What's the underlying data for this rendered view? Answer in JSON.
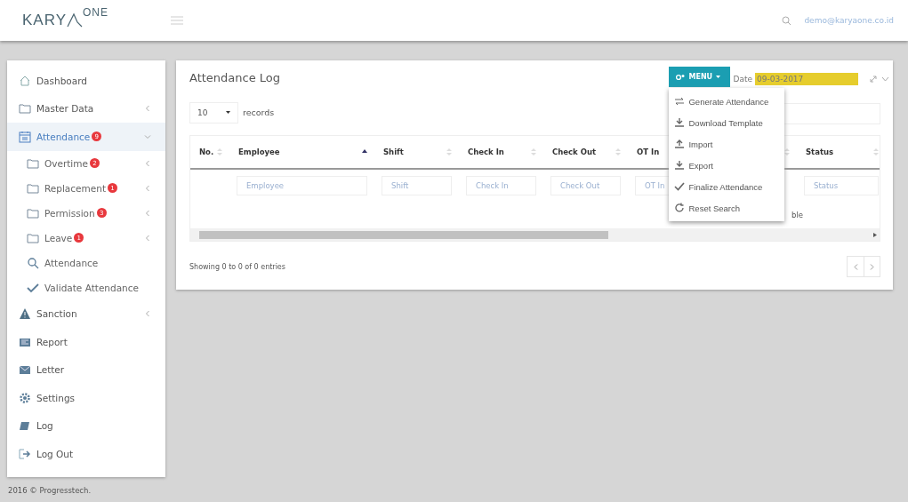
{
  "header": {
    "logo": "KARY",
    "logo_sup": "ONE",
    "user": "demo@karyaone.co.id"
  },
  "sidebar": {
    "items": [
      {
        "label": "Dashboard",
        "kind": "link",
        "selected": false
      },
      {
        "label": "Master Data",
        "kind": "group",
        "expanded": false,
        "selected": false
      },
      {
        "label": "Attendance",
        "kind": "group",
        "expanded": true,
        "selected": true,
        "badge": "9",
        "children": [
          {
            "label": "Overtime",
            "kind": "group",
            "expanded": false,
            "badge": "2"
          },
          {
            "label": "Replacement",
            "kind": "group",
            "expanded": false,
            "badge": "1"
          },
          {
            "label": "Permission",
            "kind": "group",
            "expanded": false,
            "badge": "3"
          },
          {
            "label": "Leave",
            "kind": "group",
            "expanded": false,
            "badge": "1"
          },
          {
            "label": "Attendance",
            "kind": "link"
          },
          {
            "label": "Validate Attendance",
            "kind": "link"
          }
        ]
      },
      {
        "label": "Sanction",
        "kind": "group",
        "expanded": false,
        "selected": false
      },
      {
        "label": "Report",
        "kind": "link",
        "selected": false
      },
      {
        "label": "Letter",
        "kind": "link",
        "selected": false
      },
      {
        "label": "Settings",
        "kind": "link",
        "selected": false
      },
      {
        "label": "Log",
        "kind": "link",
        "selected": false
      },
      {
        "label": "Log Out",
        "kind": "link",
        "selected": false
      }
    ]
  },
  "panel": {
    "title": "Attendance Log",
    "menu_button": "MENU",
    "date_label": "Date",
    "date_value": "09-03-2017",
    "menu": {
      "expanded": true,
      "items": [
        "Generate Attendance",
        "Download Template",
        "Import",
        "Export",
        "Finalize Attendance",
        "Reset Search"
      ]
    },
    "page_size": "10",
    "page_size_label": "records",
    "table": {
      "columns": [
        {
          "label": "No.",
          "sorted": false
        },
        {
          "label": "Employee",
          "sorted": true,
          "placeholder": "Employee"
        },
        {
          "label": "Shift",
          "sorted": false,
          "placeholder": "Shift"
        },
        {
          "label": "Check In",
          "sorted": false,
          "placeholder": "Check In"
        },
        {
          "label": "Check Out",
          "sorted": false,
          "placeholder": "Check Out"
        },
        {
          "label": "OT In",
          "placeholder": "OT In"
        },
        {
          "sorted": false
        },
        {
          "label": "Status",
          "sorted": false,
          "placeholder": "Status"
        }
      ],
      "empty_message": "ble"
    },
    "info": "Showing 0 to 0 of 0 entries"
  },
  "footer": "2016 © Progresstech."
}
